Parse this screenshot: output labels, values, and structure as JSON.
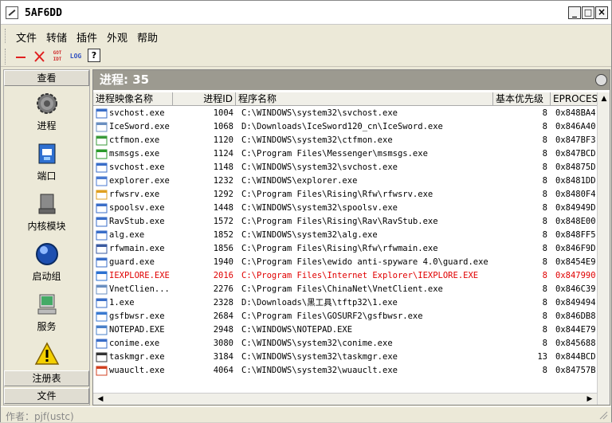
{
  "window": {
    "title": "5AF6DD",
    "minimize": "_",
    "maximize": "□",
    "close": "×"
  },
  "menu": [
    "文件",
    "转储",
    "插件",
    "外观",
    "帮助"
  ],
  "toolbar": {
    "got_idt": "GOT\nIDT",
    "log": "LOG",
    "help": "?"
  },
  "sidebar": {
    "header_top": "查看",
    "items": [
      {
        "label": "进程",
        "icon": "gear-icon"
      },
      {
        "label": "端口",
        "icon": "network-port-icon"
      },
      {
        "label": "内核模块",
        "icon": "hard-drive-icon"
      },
      {
        "label": "启动组",
        "icon": "sphere-icon"
      },
      {
        "label": "服务",
        "icon": "computer-icon"
      },
      {
        "label": "",
        "icon": "warning-icon"
      }
    ],
    "header_reg": "注册表",
    "header_file": "文件"
  },
  "main": {
    "process_count": "进程: 35",
    "columns": [
      "进程映像名称",
      "进程ID",
      "程序名称",
      "基本优先级",
      "EPROCESS"
    ],
    "rows": [
      {
        "name": "svchost.exe",
        "pid": "1004",
        "path": "C:\\WINDOWS\\system32\\svchost.exe",
        "pri": "8",
        "ep": "0x848BA4",
        "icon": "window-icon"
      },
      {
        "name": "IceSword.exe",
        "pid": "1068",
        "path": "D:\\Downloads\\IceSword120_cn\\IceSword.exe",
        "pri": "8",
        "ep": "0x846A40",
        "icon": "app-icon"
      },
      {
        "name": "ctfmon.exe",
        "pid": "1120",
        "path": "C:\\WINDOWS\\system32\\ctfmon.exe",
        "pri": "8",
        "ep": "0x847BF3",
        "icon": "pen-icon"
      },
      {
        "name": "msmsgs.exe",
        "pid": "1124",
        "path": "C:\\Program Files\\Messenger\\msmsgs.exe",
        "pri": "8",
        "ep": "0x847BCD",
        "icon": "messenger-icon"
      },
      {
        "name": "svchost.exe",
        "pid": "1148",
        "path": "C:\\WINDOWS\\system32\\svchost.exe",
        "pri": "8",
        "ep": "0x84875D",
        "icon": "window-icon"
      },
      {
        "name": "explorer.exe",
        "pid": "1232",
        "path": "C:\\WINDOWS\\explorer.exe",
        "pri": "8",
        "ep": "0x8481DD",
        "icon": "explorer-icon"
      },
      {
        "name": "rfwsrv.exe",
        "pid": "1292",
        "path": "C:\\Program Files\\Rising\\Rfw\\rfwsrv.exe",
        "pri": "8",
        "ep": "0x8480F4",
        "icon": "rising-icon"
      },
      {
        "name": "spoolsv.exe",
        "pid": "1448",
        "path": "C:\\WINDOWS\\system32\\spoolsv.exe",
        "pri": "8",
        "ep": "0x84949D",
        "icon": "window-icon"
      },
      {
        "name": "RavStub.exe",
        "pid": "1572",
        "path": "C:\\Program Files\\Rising\\Rav\\RavStub.exe",
        "pri": "8",
        "ep": "0x848E00",
        "icon": "window-icon"
      },
      {
        "name": "alg.exe",
        "pid": "1852",
        "path": "C:\\WINDOWS\\system32\\alg.exe",
        "pri": "8",
        "ep": "0x848FF5",
        "icon": "window-icon"
      },
      {
        "name": "rfwmain.exe",
        "pid": "1856",
        "path": "C:\\Program Files\\Rising\\Rfw\\rfwmain.exe",
        "pri": "8",
        "ep": "0x846F9D",
        "icon": "firewall-icon"
      },
      {
        "name": "guard.exe",
        "pid": "1940",
        "path": "C:\\Program Files\\ewido anti-spyware 4.0\\guard.exe",
        "pri": "8",
        "ep": "0x8454E9",
        "icon": "window-icon"
      },
      {
        "name": "IEXPLORE.EXE",
        "pid": "2016",
        "path": "C:\\Program Files\\Internet Explorer\\IEXPLORE.EXE",
        "pri": "8",
        "ep": "0x847990",
        "icon": "ie-icon",
        "highlight": true
      },
      {
        "name": "VnetClien...",
        "pid": "2276",
        "path": "C:\\Program Files\\ChinaNet\\VnetClient.exe",
        "pri": "8",
        "ep": "0x846C39",
        "icon": "app-icon"
      },
      {
        "name": "1.exe",
        "pid": "2328",
        "path": "D:\\Downloads\\黑工具\\tftp32\\1.exe",
        "pri": "8",
        "ep": "0x849494",
        "icon": "window-icon"
      },
      {
        "name": "gsfbwsr.exe",
        "pid": "2684",
        "path": "C:\\Program Files\\GOSURF2\\gsfbwsr.exe",
        "pri": "8",
        "ep": "0x846DB8",
        "icon": "globe-icon"
      },
      {
        "name": "NOTEPAD.EXE",
        "pid": "2948",
        "path": "C:\\WINDOWS\\NOTEPAD.EXE",
        "pri": "8",
        "ep": "0x844E79",
        "icon": "notepad-icon"
      },
      {
        "name": "conime.exe",
        "pid": "3080",
        "path": "C:\\WINDOWS\\system32\\conime.exe",
        "pri": "8",
        "ep": "0x845688",
        "icon": "window-icon"
      },
      {
        "name": "taskmgr.exe",
        "pid": "3184",
        "path": "C:\\WINDOWS\\system32\\taskmgr.exe",
        "pri": "13",
        "ep": "0x844BCD",
        "icon": "taskmgr-icon"
      },
      {
        "name": "wuauclt.exe",
        "pid": "4064",
        "path": "C:\\WINDOWS\\system32\\wuauclt.exe",
        "pri": "8",
        "ep": "0x84757B",
        "icon": "windows-update-icon"
      }
    ]
  },
  "status": {
    "text": "作者：pjf(ustc)"
  },
  "colors": {
    "highlight_row": "#e00000",
    "process_header": "#9c9a90"
  }
}
